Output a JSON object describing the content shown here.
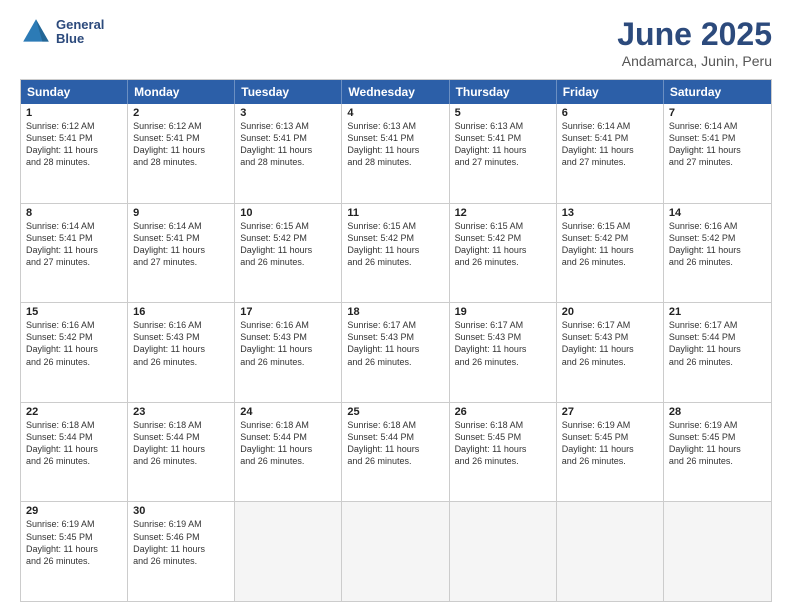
{
  "logo": {
    "line1": "General",
    "line2": "Blue"
  },
  "header": {
    "month": "June 2025",
    "location": "Andamarca, Junin, Peru"
  },
  "weekdays": [
    "Sunday",
    "Monday",
    "Tuesday",
    "Wednesday",
    "Thursday",
    "Friday",
    "Saturday"
  ],
  "rows": [
    [
      {
        "day": "1",
        "text": "Sunrise: 6:12 AM\nSunset: 5:41 PM\nDaylight: 11 hours\nand 28 minutes."
      },
      {
        "day": "2",
        "text": "Sunrise: 6:12 AM\nSunset: 5:41 PM\nDaylight: 11 hours\nand 28 minutes."
      },
      {
        "day": "3",
        "text": "Sunrise: 6:13 AM\nSunset: 5:41 PM\nDaylight: 11 hours\nand 28 minutes."
      },
      {
        "day": "4",
        "text": "Sunrise: 6:13 AM\nSunset: 5:41 PM\nDaylight: 11 hours\nand 28 minutes."
      },
      {
        "day": "5",
        "text": "Sunrise: 6:13 AM\nSunset: 5:41 PM\nDaylight: 11 hours\nand 27 minutes."
      },
      {
        "day": "6",
        "text": "Sunrise: 6:14 AM\nSunset: 5:41 PM\nDaylight: 11 hours\nand 27 minutes."
      },
      {
        "day": "7",
        "text": "Sunrise: 6:14 AM\nSunset: 5:41 PM\nDaylight: 11 hours\nand 27 minutes."
      }
    ],
    [
      {
        "day": "8",
        "text": "Sunrise: 6:14 AM\nSunset: 5:41 PM\nDaylight: 11 hours\nand 27 minutes."
      },
      {
        "day": "9",
        "text": "Sunrise: 6:14 AM\nSunset: 5:41 PM\nDaylight: 11 hours\nand 27 minutes."
      },
      {
        "day": "10",
        "text": "Sunrise: 6:15 AM\nSunset: 5:42 PM\nDaylight: 11 hours\nand 26 minutes."
      },
      {
        "day": "11",
        "text": "Sunrise: 6:15 AM\nSunset: 5:42 PM\nDaylight: 11 hours\nand 26 minutes."
      },
      {
        "day": "12",
        "text": "Sunrise: 6:15 AM\nSunset: 5:42 PM\nDaylight: 11 hours\nand 26 minutes."
      },
      {
        "day": "13",
        "text": "Sunrise: 6:15 AM\nSunset: 5:42 PM\nDaylight: 11 hours\nand 26 minutes."
      },
      {
        "day": "14",
        "text": "Sunrise: 6:16 AM\nSunset: 5:42 PM\nDaylight: 11 hours\nand 26 minutes."
      }
    ],
    [
      {
        "day": "15",
        "text": "Sunrise: 6:16 AM\nSunset: 5:42 PM\nDaylight: 11 hours\nand 26 minutes."
      },
      {
        "day": "16",
        "text": "Sunrise: 6:16 AM\nSunset: 5:43 PM\nDaylight: 11 hours\nand 26 minutes."
      },
      {
        "day": "17",
        "text": "Sunrise: 6:16 AM\nSunset: 5:43 PM\nDaylight: 11 hours\nand 26 minutes."
      },
      {
        "day": "18",
        "text": "Sunrise: 6:17 AM\nSunset: 5:43 PM\nDaylight: 11 hours\nand 26 minutes."
      },
      {
        "day": "19",
        "text": "Sunrise: 6:17 AM\nSunset: 5:43 PM\nDaylight: 11 hours\nand 26 minutes."
      },
      {
        "day": "20",
        "text": "Sunrise: 6:17 AM\nSunset: 5:43 PM\nDaylight: 11 hours\nand 26 minutes."
      },
      {
        "day": "21",
        "text": "Sunrise: 6:17 AM\nSunset: 5:44 PM\nDaylight: 11 hours\nand 26 minutes."
      }
    ],
    [
      {
        "day": "22",
        "text": "Sunrise: 6:18 AM\nSunset: 5:44 PM\nDaylight: 11 hours\nand 26 minutes."
      },
      {
        "day": "23",
        "text": "Sunrise: 6:18 AM\nSunset: 5:44 PM\nDaylight: 11 hours\nand 26 minutes."
      },
      {
        "day": "24",
        "text": "Sunrise: 6:18 AM\nSunset: 5:44 PM\nDaylight: 11 hours\nand 26 minutes."
      },
      {
        "day": "25",
        "text": "Sunrise: 6:18 AM\nSunset: 5:44 PM\nDaylight: 11 hours\nand 26 minutes."
      },
      {
        "day": "26",
        "text": "Sunrise: 6:18 AM\nSunset: 5:45 PM\nDaylight: 11 hours\nand 26 minutes."
      },
      {
        "day": "27",
        "text": "Sunrise: 6:19 AM\nSunset: 5:45 PM\nDaylight: 11 hours\nand 26 minutes."
      },
      {
        "day": "28",
        "text": "Sunrise: 6:19 AM\nSunset: 5:45 PM\nDaylight: 11 hours\nand 26 minutes."
      }
    ],
    [
      {
        "day": "29",
        "text": "Sunrise: 6:19 AM\nSunset: 5:45 PM\nDaylight: 11 hours\nand 26 minutes."
      },
      {
        "day": "30",
        "text": "Sunrise: 6:19 AM\nSunset: 5:46 PM\nDaylight: 11 hours\nand 26 minutes."
      },
      {
        "day": "",
        "text": ""
      },
      {
        "day": "",
        "text": ""
      },
      {
        "day": "",
        "text": ""
      },
      {
        "day": "",
        "text": ""
      },
      {
        "day": "",
        "text": ""
      }
    ]
  ]
}
